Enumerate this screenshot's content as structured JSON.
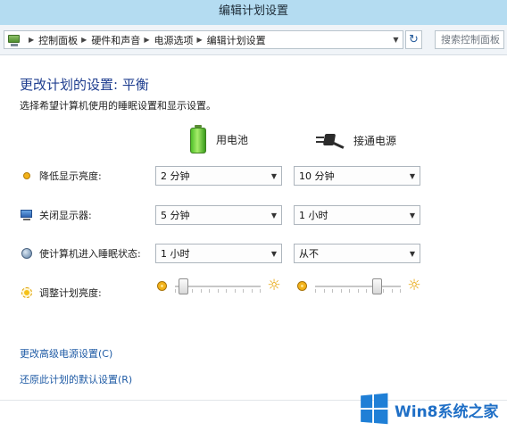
{
  "window": {
    "title": "编辑计划设置"
  },
  "address_bar": {
    "breadcrumbs": [
      "控制面板",
      "硬件和声音",
      "电源选项",
      "编辑计划设置"
    ],
    "search_placeholder": "搜索控制面板"
  },
  "page": {
    "heading": "更改计划的设置: 平衡",
    "subtitle": "选择希望计算机使用的睡眠设置和显示设置。",
    "columns": {
      "battery": "用电池",
      "plugged_in": "接通电源"
    }
  },
  "settings": {
    "dim_display": {
      "label": "降低显示亮度:",
      "battery_value": "2 分钟",
      "plugged_value": "10 分钟"
    },
    "turn_off_display": {
      "label": "关闭显示器:",
      "battery_value": "5 分钟",
      "plugged_value": "1 小时"
    },
    "sleep": {
      "label": "使计算机进入睡眠状态:",
      "battery_value": "1 小时",
      "plugged_value": "从不"
    },
    "brightness": {
      "label": "调整计划亮度:",
      "battery_level": 0.05,
      "plugged_level": 0.75
    }
  },
  "links": {
    "advanced": "更改高级电源设置(C)",
    "restore": "还原此计划的默认设置(R)"
  },
  "watermark": {
    "text": "Win8系统之家",
    "color": "#1f7fd6"
  }
}
